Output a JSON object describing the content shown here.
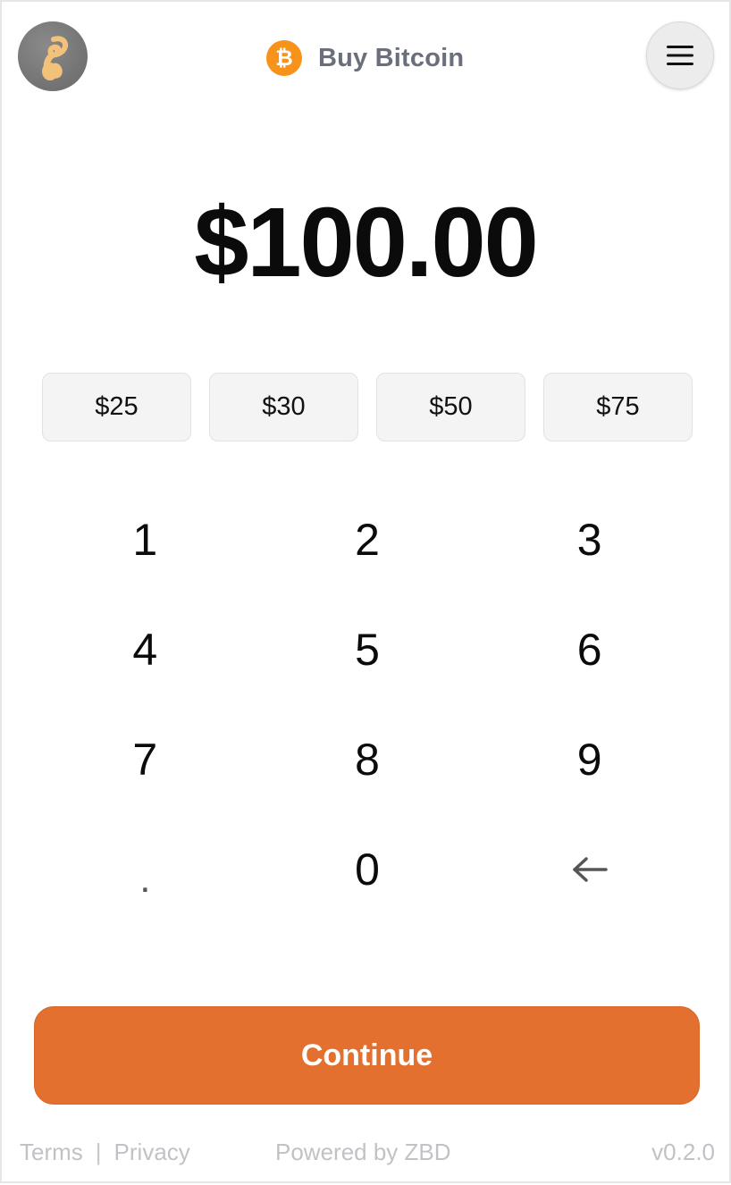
{
  "header": {
    "title": "Buy Bitcoin",
    "avatar_icon": "avatar-logo",
    "bitcoin_icon": "bitcoin-icon",
    "menu_icon": "hamburger-menu-icon"
  },
  "amount": {
    "display": "$100.00"
  },
  "presets": [
    {
      "label": "$25"
    },
    {
      "label": "$30"
    },
    {
      "label": "$50"
    },
    {
      "label": "$75"
    }
  ],
  "keypad": {
    "keys": [
      "1",
      "2",
      "3",
      "4",
      "5",
      "6",
      "7",
      "8",
      "9",
      ".",
      "0"
    ],
    "backspace_icon": "arrow-left-icon"
  },
  "continue_label": "Continue",
  "footer": {
    "terms": "Terms",
    "separator": "|",
    "privacy": "Privacy",
    "powered_by": "Powered by ZBD",
    "version": "v0.2.0"
  },
  "colors": {
    "accent": "#e3702f",
    "bitcoin": "#f7931a",
    "title_gray": "#6b6f7b",
    "footer_gray": "#c2c2c6"
  }
}
